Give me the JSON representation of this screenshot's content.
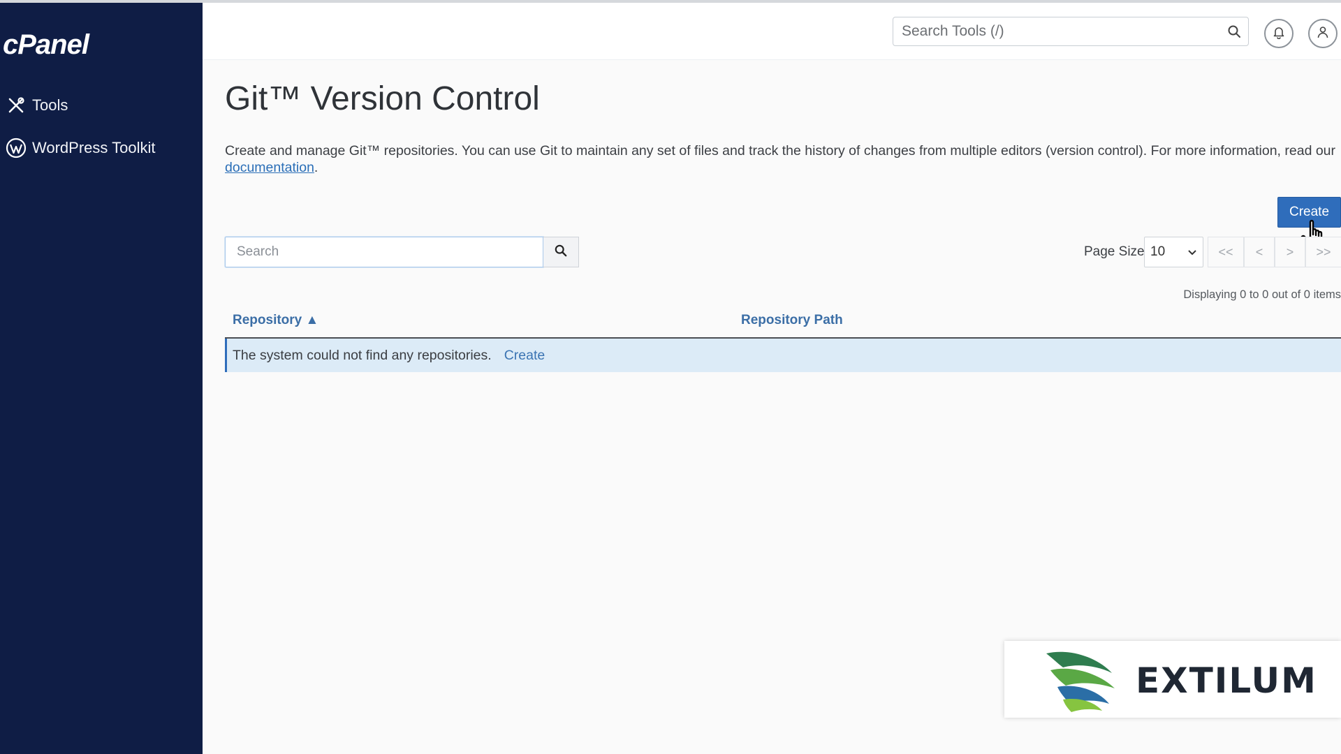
{
  "sidebar": {
    "logo": "cPanel",
    "items": [
      {
        "label": "Tools",
        "icon": "tools-icon"
      },
      {
        "label": "WordPress Toolkit",
        "icon": "wordpress-icon"
      }
    ]
  },
  "header": {
    "search_placeholder": "Search Tools (/)",
    "icons": [
      "search-icon",
      "bell-icon",
      "user-icon"
    ]
  },
  "page": {
    "title": "Git™ Version Control",
    "description": "Create and manage Git™ repositories. You can use Git to maintain any set of files and track the history of changes from multiple editors (version control). For more information, read our",
    "doc_link": "documentation",
    "doc_suffix": ".",
    "create_button": "Create"
  },
  "toolbar": {
    "search_placeholder": "Search",
    "page_size_label": "Page Size",
    "page_size_value": "10",
    "pager": {
      "first": "<<",
      "prev": "<",
      "next": ">",
      "last": ">>"
    },
    "displaying": "Displaying 0 to 0 out of 0 items"
  },
  "table": {
    "columns": [
      {
        "label": "Repository",
        "sort": "▲"
      },
      {
        "label": "Repository Path"
      }
    ],
    "empty_message": "The system could not find any repositories.",
    "empty_link": "Create"
  },
  "watermark": {
    "text": "EXTILUM"
  },
  "colors": {
    "sidebar_bg": "#0f1d45",
    "primary": "#2f6dbb",
    "link": "#2a6eb7",
    "empty_row_bg": "#dcebf7"
  }
}
